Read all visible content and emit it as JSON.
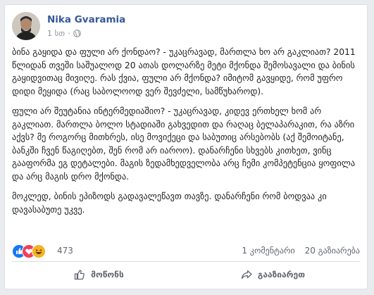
{
  "post": {
    "author": "Nika Gvaramia",
    "timestamp": "1 სთ",
    "visibility_icon": "globe-icon",
    "paragraphs": [
      "ბინა გაყიდა და ფული არ ქონდაო? - უკაცრავად, მართლა ხო არ გაკლიათ? 2011 წლიდან თვეში საშუალოდ 20 ათას დოლარზე მეტი მქონდა შემოსავალი და ბინის გაყიდვითაც მივიღე. რას ქვია, ფული არ მქონდა? იმიტომ გავყიდე, რომ უფრო დიდი მეყიდა (რაც საბოლოოდ ვერ შევძელი, სამწუხაროდ).",
      "ფული არ შეუტანია ინტერმედიაშიო? - უკაცრავად, კიდევ ერთხელ ხომ არ გაკლიათ. მართლა ბოლო სტადიაში გახვედით და რაღაც ბელაპარაკით, რა აზრი აქვს? მე როგორც მითხრეს, ისე მოვიქეცი და საბუთიც არსებობს (აქ შემოიტანე, ბანკში ჩვენ წაგიღებთ, შენ რომ არ იაროო). დანარჩენი სხვებს კითხეთ, ვინც გააფორმა ეგ დეტალები. მაგის ზედამხედველობა არც ჩემი კომპეტენცია ყოფილა და არც მაგის დრო მქონდა.",
      "მოკლედ, ბინის ეპიზოდს გადავალეწავთ თავზე. დანარჩენი რომ ბოდვაა კი დავასაბუთე უკვე."
    ]
  },
  "reactions": {
    "count": "473",
    "icons": [
      "like-icon",
      "love-icon",
      "haha-icon"
    ],
    "colors": {
      "like": "#1877f2",
      "love": "#f33e58",
      "haha": "#f7b125"
    }
  },
  "stats": {
    "comments": "1 კომენტარი",
    "shares": "20 გაზიარება"
  },
  "actions": {
    "like_label": "მოწონს",
    "share_label": "გააზიარეთ"
  }
}
